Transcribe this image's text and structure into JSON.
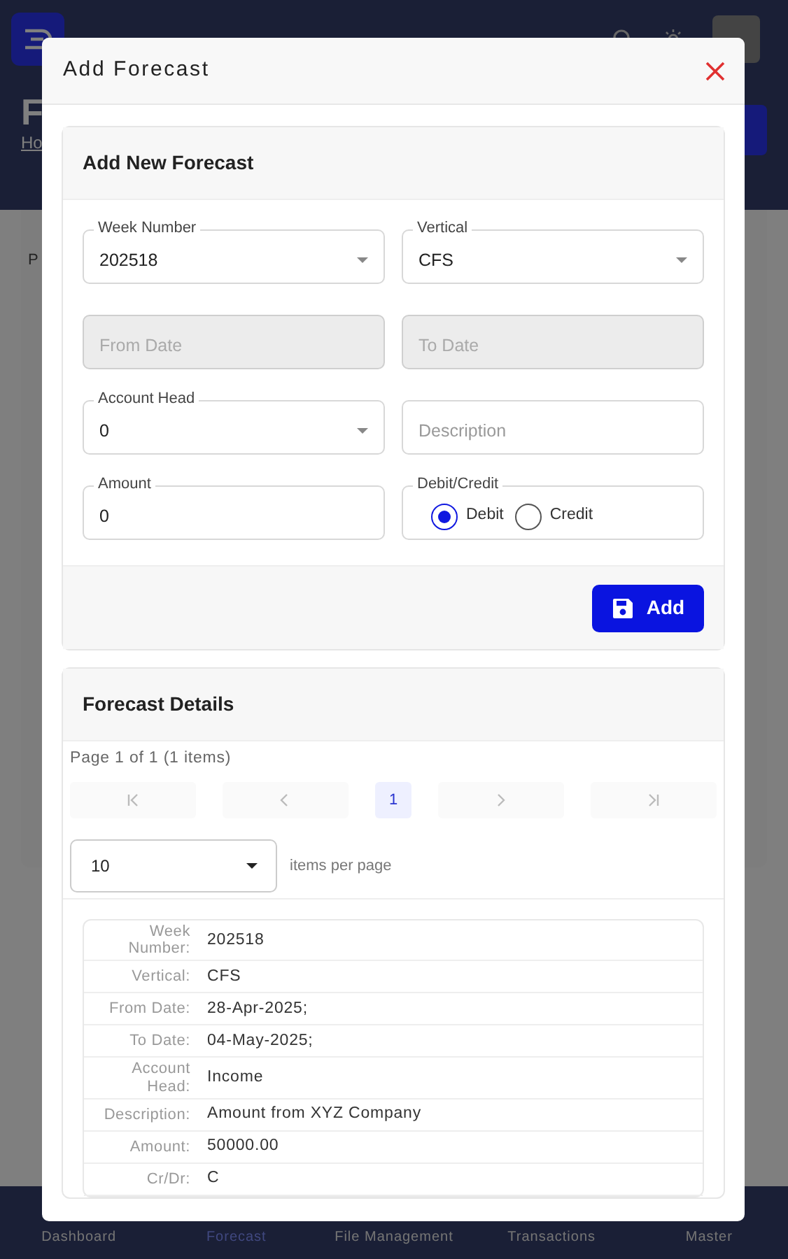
{
  "page": {
    "title": "F",
    "breadcrumb": "Ho",
    "fragment": "P"
  },
  "modal": {
    "title": "Add Forecast",
    "form": {
      "title": "Add New Forecast",
      "fields": [
        {
          "kind": "select",
          "label": "Week Number",
          "value": "202518"
        },
        {
          "kind": "select",
          "label": "Vertical",
          "value": "CFS"
        },
        {
          "kind": "input",
          "placeholder": "From Date",
          "disabled": true
        },
        {
          "kind": "input",
          "placeholder": "To Date",
          "disabled": true
        },
        {
          "kind": "select",
          "label": "Account Head",
          "value": "0"
        },
        {
          "kind": "input",
          "placeholder": "Description",
          "disabled": false
        },
        {
          "kind": "input",
          "label": "Amount",
          "value": "0",
          "disabled": false
        },
        {
          "kind": "radio",
          "label": "Debit/Credit",
          "options": [
            {
              "label": "Debit",
              "selected": true
            },
            {
              "label": "Credit",
              "selected": false
            }
          ]
        }
      ],
      "button": "Add"
    },
    "details": {
      "title": "Forecast Details",
      "page_info": "Page 1 of 1 (1 items)",
      "pager": [
        {
          "kind": "first"
        },
        {
          "kind": "prev"
        },
        {
          "kind": "page",
          "label": "1",
          "selected": true
        },
        {
          "kind": "next"
        },
        {
          "kind": "last"
        }
      ],
      "page_size": "10",
      "page_size_label": "items per page",
      "rows": [
        {
          "label": "Week Number:",
          "value": "202518"
        },
        {
          "label": "Vertical:",
          "value": "CFS"
        },
        {
          "label": "From Date:",
          "value": "28-Apr-2025;"
        },
        {
          "label": "To Date:",
          "value": "04-May-2025;"
        },
        {
          "label": "Account Head:",
          "value": "Income"
        },
        {
          "label": "Description:",
          "value": "Amount from XYZ Company"
        },
        {
          "label": "Amount:",
          "value": "50000.00"
        },
        {
          "label": "Cr/Dr:",
          "value": "C"
        }
      ]
    }
  },
  "bottom_nav": [
    {
      "label": "Dashboard",
      "selected": false
    },
    {
      "label": "Forecast",
      "selected": true
    },
    {
      "label": "File Management",
      "selected": false
    },
    {
      "label": "Transactions",
      "selected": false
    },
    {
      "label": "Master",
      "selected": false
    }
  ]
}
